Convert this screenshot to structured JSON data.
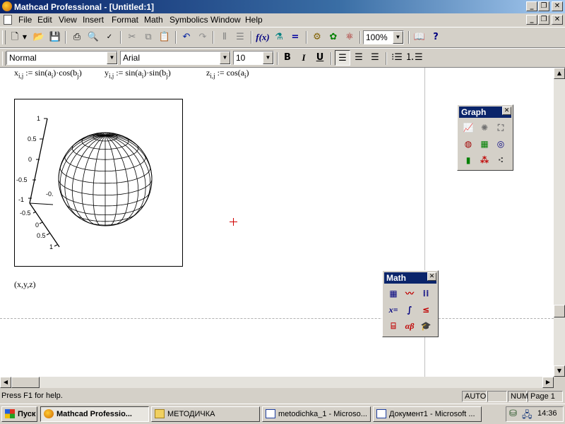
{
  "window": {
    "title": "Mathcad Professional - [Untitled:1]",
    "minimize": "_",
    "maximize": "❐",
    "close": "✕"
  },
  "menu": [
    "File",
    "Edit",
    "View",
    "Insert",
    "Format",
    "Math",
    "Symbolics",
    "Window",
    "Help"
  ],
  "toolbar": {
    "zoom": "100%"
  },
  "format_bar": {
    "style": "Normal",
    "font": "Arial",
    "size": "10",
    "bold": "B",
    "italic": "I",
    "underline": "U"
  },
  "worksheet": {
    "eq_x": {
      "lhs": "x",
      "sub": "i,j",
      "rhs_a": "sin(a",
      "rhs_b": ")·cos(b",
      "sub_i": "i",
      "sub_j": "j",
      "end": ")"
    },
    "eq_y": {
      "lhs": "y",
      "sub": "i,j",
      "rhs_a": "sin(a",
      "rhs_b": ")·sin(b",
      "sub_i": "i",
      "sub_j": "j",
      "end": ")"
    },
    "eq_z": {
      "lhs": "z",
      "sub": "i,j",
      "rhs_a": "cos(a",
      "sub_i": "i",
      "end": ")"
    },
    "assign": ":=",
    "plot_label": "(x,y,z)",
    "plot_axis_labels": [
      "1",
      "0.5",
      "0",
      "-0.5",
      "-1",
      "-0.5",
      "0",
      "0.5",
      "1",
      "-0."
    ]
  },
  "palettes": {
    "graph": {
      "title": "Graph",
      "close": "✕"
    },
    "math": {
      "title": "Math",
      "close": "✕",
      "icons": [
        "x=",
        "αβ"
      ]
    }
  },
  "status": {
    "help": "Press F1 for help.",
    "mode": "AUTO",
    "num": "NUM",
    "page": "Page 1"
  },
  "taskbar": {
    "start": "Пуск",
    "items": [
      "Mathcad Professio...",
      "МЕТОДИЧКА",
      "metodichka_1 - Microso...",
      "Документ1 - Microsoft ..."
    ],
    "clock": "14:36"
  }
}
